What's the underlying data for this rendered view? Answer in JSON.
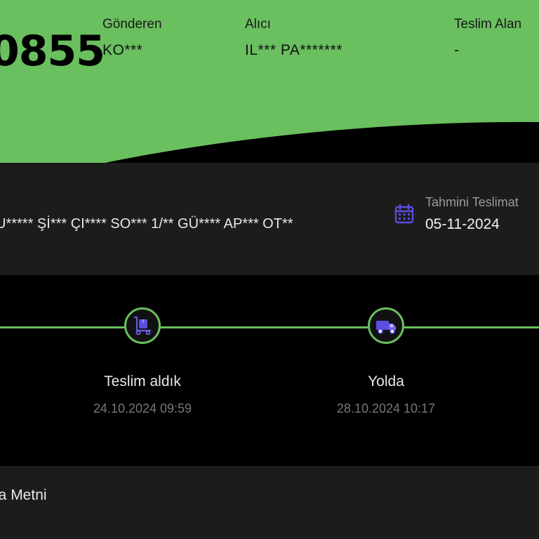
{
  "shipment": {
    "tracking_number_visible": "0855"
  },
  "parties": {
    "sender": {
      "label": "Gönderen",
      "value": "KO***"
    },
    "receiver": {
      "label": "Alıcı",
      "value": "IL*** PA*******"
    },
    "delivered_to": {
      "label": "Teslim Alan",
      "value": "-"
    }
  },
  "address": {
    "text": "U***** Şİ*** ÇI**** SO*** 1/** GÜ**** AP*** OT**"
  },
  "eta": {
    "label": "Tahmini Teslimat",
    "value": "05-11-2024",
    "icon": "calendar-icon"
  },
  "timeline": {
    "steps": [
      {
        "title": "Teslim aldık",
        "time": "24.10.2024 09:59",
        "icon": "hand-truck-icon",
        "status": "done"
      },
      {
        "title": "Yolda",
        "time": "28.10.2024 10:17",
        "icon": "truck-icon",
        "status": "done"
      }
    ]
  },
  "bottom": {
    "text": "na Metni"
  },
  "colors": {
    "accent_green": "#6abf5f",
    "icon_purple": "#5b4de0",
    "dark_band": "#1c1c1c",
    "background": "#000000"
  }
}
